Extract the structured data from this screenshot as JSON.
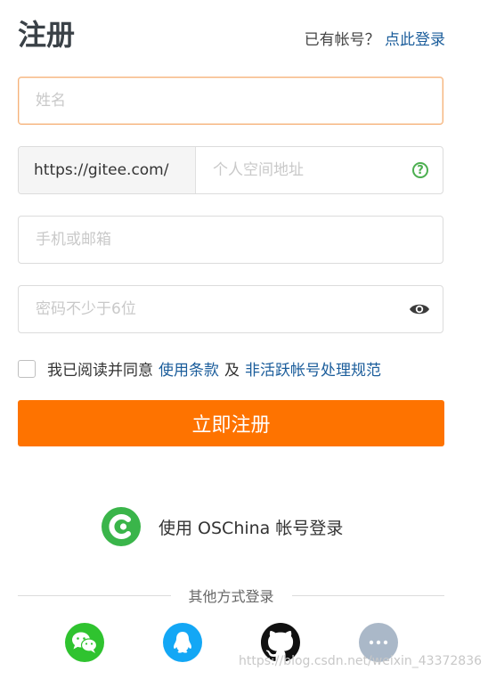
{
  "header": {
    "title": "注册",
    "login_prompt": "已有帐号？",
    "login_link": "点此登录"
  },
  "form": {
    "name": {
      "placeholder": "姓名",
      "value": ""
    },
    "space": {
      "prefix": "https://gitee.com/",
      "placeholder": "个人空间地址",
      "value": ""
    },
    "contact": {
      "placeholder": "手机或邮箱",
      "value": ""
    },
    "password": {
      "placeholder": "密码不少于6位",
      "value": ""
    }
  },
  "agreement": {
    "checked": false,
    "text": "我已阅读并同意",
    "terms_link": "使用条款",
    "and": "及",
    "policy_link": "非活跃帐号处理规范"
  },
  "submit_label": "立即注册",
  "oschina": {
    "label": "使用 OSChina 帐号登录"
  },
  "other_login": {
    "label": "其他方式登录"
  },
  "social": [
    "wechat-icon",
    "qq-icon",
    "github-icon",
    "more-icon"
  ],
  "watermark": "https://blog.csdn.net/weixin_43372836",
  "colors": {
    "accent": "#fe7300",
    "link": "#1b5d9b",
    "focus_border": "#f6b27a",
    "wechat": "#2fc32f",
    "qq": "#13a7f5",
    "oschina": "#3ab54a"
  }
}
